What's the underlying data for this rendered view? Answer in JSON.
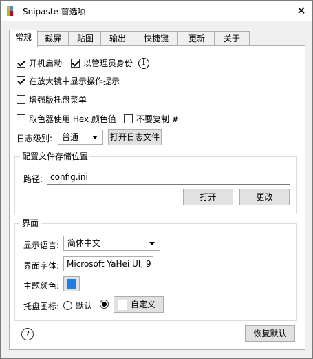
{
  "window": {
    "title": "Snipaste 首选项",
    "close_glyph": "✕"
  },
  "tabs": [
    "常规",
    "截屏",
    "贴图",
    "输出",
    "快捷键",
    "更新",
    "关于"
  ],
  "general": {
    "autostart": {
      "label": "开机启动",
      "checked": true
    },
    "run_as_admin": {
      "label": "以管理员身份",
      "checked": true
    },
    "info_glyph": "i",
    "show_magnifier_hints": {
      "label": "在放大镜中显示操作提示",
      "checked": true
    },
    "enhanced_tray_menu": {
      "label": "增强版托盘菜单",
      "checked": false
    },
    "color_picker_hex": {
      "label": "取色器使用 Hex 颜色值",
      "checked": false
    },
    "no_copy_hash": {
      "label": "不要复制 #",
      "checked": false
    },
    "log_level": {
      "label": "日志级别:",
      "value": "普通"
    },
    "open_log_button": "打开日志文件"
  },
  "config_location": {
    "title": "配置文件存储位置",
    "path_label": "路径:",
    "path_value": "config.ini",
    "open_button": "打开",
    "change_button": "更改"
  },
  "interface": {
    "title": "界面",
    "language_label": "显示语言:",
    "language_value": "简体中文",
    "font_label": "界面字体:",
    "font_value": "Microsoft YaHei UI, 9",
    "theme_color_label": "主题颜色:",
    "theme_color": "#1e7de6",
    "tray_icon_label": "托盘图标:",
    "tray_default_label": "默认",
    "tray_custom_label": "自定义",
    "tray_selected": "custom"
  },
  "footer": {
    "help_glyph": "?",
    "restore_defaults_button": "恢复默认"
  },
  "icons": {
    "app": "snipaste-logo-icon",
    "close": "close-icon",
    "info": "info-icon",
    "help": "help-icon"
  }
}
